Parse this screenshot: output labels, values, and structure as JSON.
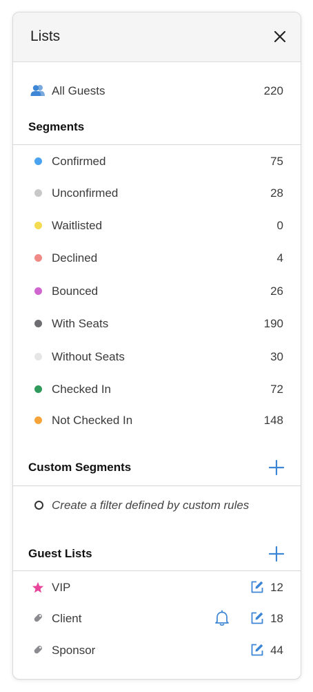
{
  "header": {
    "title": "Lists"
  },
  "all_guests": {
    "label": "All Guests",
    "count": "220"
  },
  "segments": {
    "title": "Segments",
    "items": [
      {
        "label": "Confirmed",
        "count": "75",
        "color": "#4aa3f0"
      },
      {
        "label": "Unconfirmed",
        "count": "28",
        "color": "#c8c8c8"
      },
      {
        "label": "Waitlisted",
        "count": "0",
        "color": "#f4dc52"
      },
      {
        "label": "Declined",
        "count": "4",
        "color": "#f08a86"
      },
      {
        "label": "Bounced",
        "count": "26",
        "color": "#d165d0"
      },
      {
        "label": "With Seats",
        "count": "190",
        "color": "#6e6e72"
      },
      {
        "label": "Without Seats",
        "count": "30",
        "color": "#e6e6e6"
      },
      {
        "label": "Checked In",
        "count": "72",
        "color": "#2f9a5b"
      },
      {
        "label": "Not Checked In",
        "count": "148",
        "color": "#f6a33a"
      }
    ]
  },
  "custom_segments": {
    "title": "Custom Segments",
    "hint": "Create a filter defined by custom rules"
  },
  "guest_lists": {
    "title": "Guest Lists",
    "items": [
      {
        "label": "VIP",
        "count": "12",
        "icon": "star-icon"
      },
      {
        "label": "Client",
        "count": "18",
        "icon": "tag-icon"
      },
      {
        "label": "Sponsor",
        "count": "44",
        "icon": "tag-icon"
      }
    ]
  },
  "colors": {
    "accent": "#3d86d6",
    "star": "#e8459a",
    "tag": "#8b8b90"
  }
}
